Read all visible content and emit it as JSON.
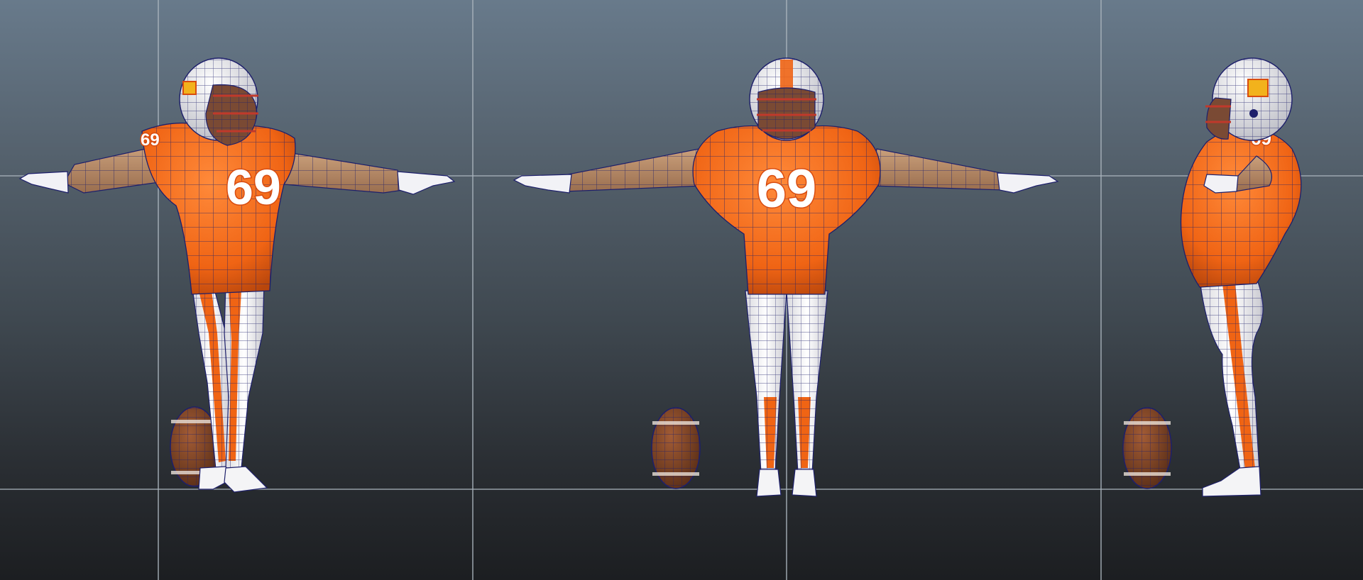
{
  "viewport": {
    "type": "3d-modeling-orthographic-views",
    "background_top": "#687a8b",
    "background_bottom": "#1c1e21",
    "grid_line_color": "#aab4bd",
    "wire_color": "#1d1f6b"
  },
  "character": {
    "jersey_number": "69",
    "jersey_color": "#f06414",
    "pants_color": "#f2f2f2",
    "skin_color": "#b98d6a",
    "helmet_color": "#f0f0f0",
    "helmet_logo_color": "#f2b21c"
  },
  "views": [
    {
      "name": "three-quarter-view"
    },
    {
      "name": "front-view"
    },
    {
      "name": "side-view"
    }
  ],
  "props": {
    "football_color": "#7a4426"
  }
}
